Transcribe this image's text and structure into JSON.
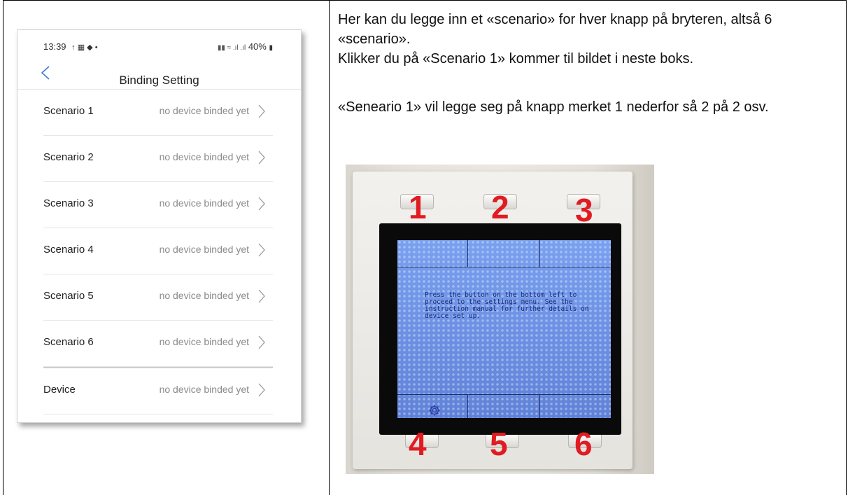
{
  "phone": {
    "status": {
      "time": "13:39",
      "indicators": "↑ ▦ ◆  •",
      "battery": "40%"
    },
    "title": "Binding Setting",
    "back_icon": "chevron-left-icon",
    "rows": [
      {
        "name": "Scenario 1",
        "status": "no device binded yet"
      },
      {
        "name": "Scenario 2",
        "status": "no device binded yet"
      },
      {
        "name": "Scenario 3",
        "status": "no device binded yet"
      },
      {
        "name": "Scenario 4",
        "status": "no device binded yet"
      },
      {
        "name": "Scenario 5",
        "status": "no device binded yet"
      },
      {
        "name": "Scenario 6",
        "status": "no device binded yet"
      },
      {
        "name": "Device",
        "status": "no device binded yet"
      }
    ]
  },
  "description": {
    "p1": "Her kan du legge inn et «scenario» for hver knapp på bryteren, altså 6 «scenario».",
    "p2": "Klikker du på «Scenario 1» kommer til bildet i neste boks.",
    "p3": "«Seneario 1» vil legge seg på knapp merket 1 nederfor så 2 på 2 osv."
  },
  "device_photo": {
    "labels": [
      "1",
      "2",
      "3",
      "4",
      "5",
      "6"
    ],
    "screen_text": "Press the button on the bottom left to proceed to the settings menu. See the instruction manual for further details on device set up.",
    "label_color": "#e11b22",
    "screen_color": "#6b8fe0"
  }
}
